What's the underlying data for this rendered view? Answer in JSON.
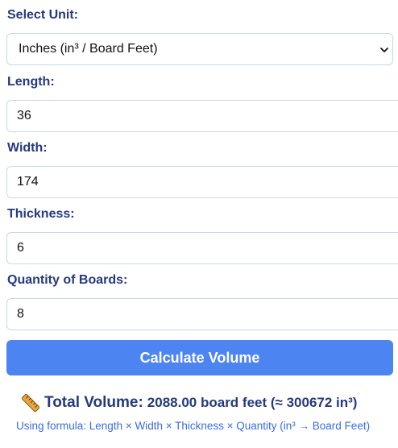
{
  "unit": {
    "label": "Select Unit:",
    "selected": "Inches (in³ / Board Feet)"
  },
  "fields": {
    "length": {
      "label": "Length:",
      "value": "36"
    },
    "width": {
      "label": "Width:",
      "value": "174"
    },
    "thickness": {
      "label": "Thickness:",
      "value": "6"
    },
    "quantity": {
      "label": "Quantity of Boards:",
      "value": "8"
    }
  },
  "button": {
    "label": "Calculate Volume"
  },
  "result": {
    "icon": "ruler-icon",
    "total_label": "Total Volume:",
    "total_value": "2088.00 board feet (≈ 300672 in³)",
    "formula": "Using formula: Length × Width × Thickness × Quantity (in³ → Board Feet)"
  },
  "colors": {
    "label_text": "#253a7e",
    "button_bg": "#4c85f2",
    "formula_text": "#3a6ce0",
    "field_border": "#c5d8e7"
  }
}
